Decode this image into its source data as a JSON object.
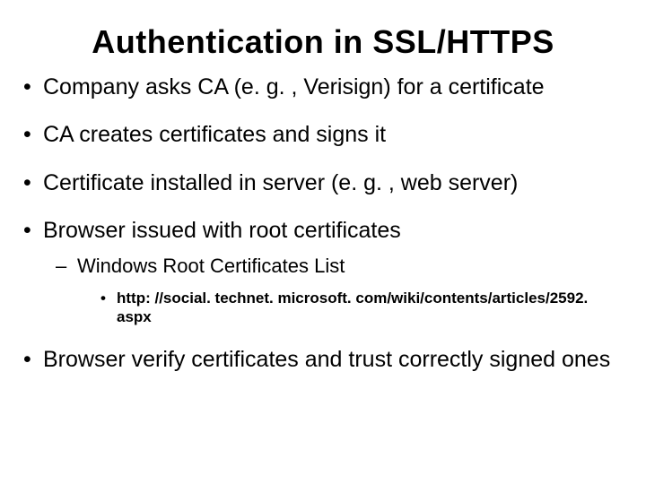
{
  "title": "Authentication in SSL/HTTPS",
  "bullets": {
    "b1": "Company asks CA (e. g. , Verisign) for a  certificate",
    "b2": "CA creates certificates and signs it",
    "b3": "Certificate installed in server (e. g. , web server)",
    "b4": "Browser issued  with root certificates",
    "b4s1": "Windows Root Certificates List",
    "b4s1a": "http: //social. technet. microsoft. com/wiki/contents/articles/2592. aspx",
    "b5": "Browser verify certificates and trust correctly signed ones"
  }
}
